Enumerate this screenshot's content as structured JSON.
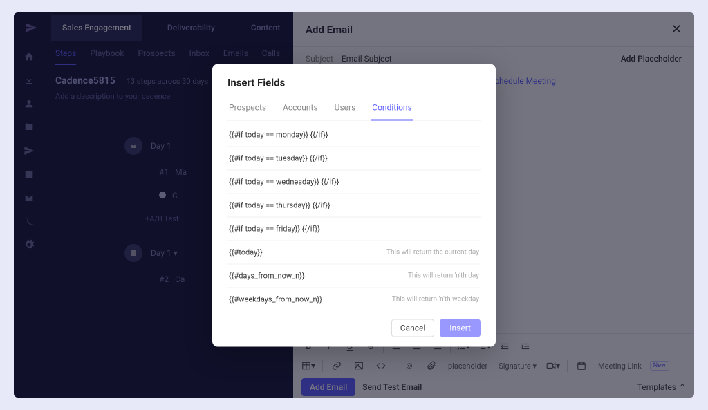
{
  "topnav": {
    "items": [
      "Sales Engagement",
      "Deliverability",
      "Content"
    ]
  },
  "subtabs": [
    "Steps",
    "Playbook",
    "Prospects",
    "Inbox",
    "Emails",
    "Calls"
  ],
  "cadence": {
    "title": "Cadence5815",
    "meta": "13 steps across 30 days",
    "desc": "Add a description to your cadence"
  },
  "timeline": {
    "day1_a": "Day 1",
    "step1": "#1",
    "step1_label": "Ma",
    "step1b_label": "C",
    "ab": "+A/B Test",
    "day1_b": "Day 1 ▾",
    "step2": "#2",
    "step2_label": "Ca"
  },
  "panel": {
    "title": "Add Email",
    "subject_label": "Subject",
    "subject_value": "Email Subject",
    "add_ph": "Add Placeholder",
    "schedule": "chedule Meeting",
    "toolbar2": {
      "placeholder": "placeholder",
      "signature": "Signature",
      "meeting": "Meeting Link",
      "new": "New"
    },
    "footer": {
      "add": "Add Email",
      "send": "Send Test Email",
      "templates": "Templates"
    }
  },
  "modal": {
    "title": "Insert Fields",
    "tabs": [
      "Prospects",
      "Accounts",
      "Users",
      "Conditions"
    ],
    "fields": [
      {
        "code": "{{#if today == monday}} {{/if}}",
        "hint": ""
      },
      {
        "code": "{{#if today == tuesday}} {{/if}}",
        "hint": ""
      },
      {
        "code": "{{#if today == wednesday}} {{/if}}",
        "hint": ""
      },
      {
        "code": "{{#if today == thursday}} {{/if}}",
        "hint": ""
      },
      {
        "code": "{{#if today == friday}} {{/if}}",
        "hint": ""
      },
      {
        "code": "{{#today}}",
        "hint": "This will return the current day"
      },
      {
        "code": "{{#days_from_now_n}}",
        "hint": "This will return 'n'th day"
      },
      {
        "code": "{{#weekdays_from_now_n}}",
        "hint": "This will return 'n'th weekday"
      }
    ],
    "cancel": "Cancel",
    "insert": "Insert"
  }
}
